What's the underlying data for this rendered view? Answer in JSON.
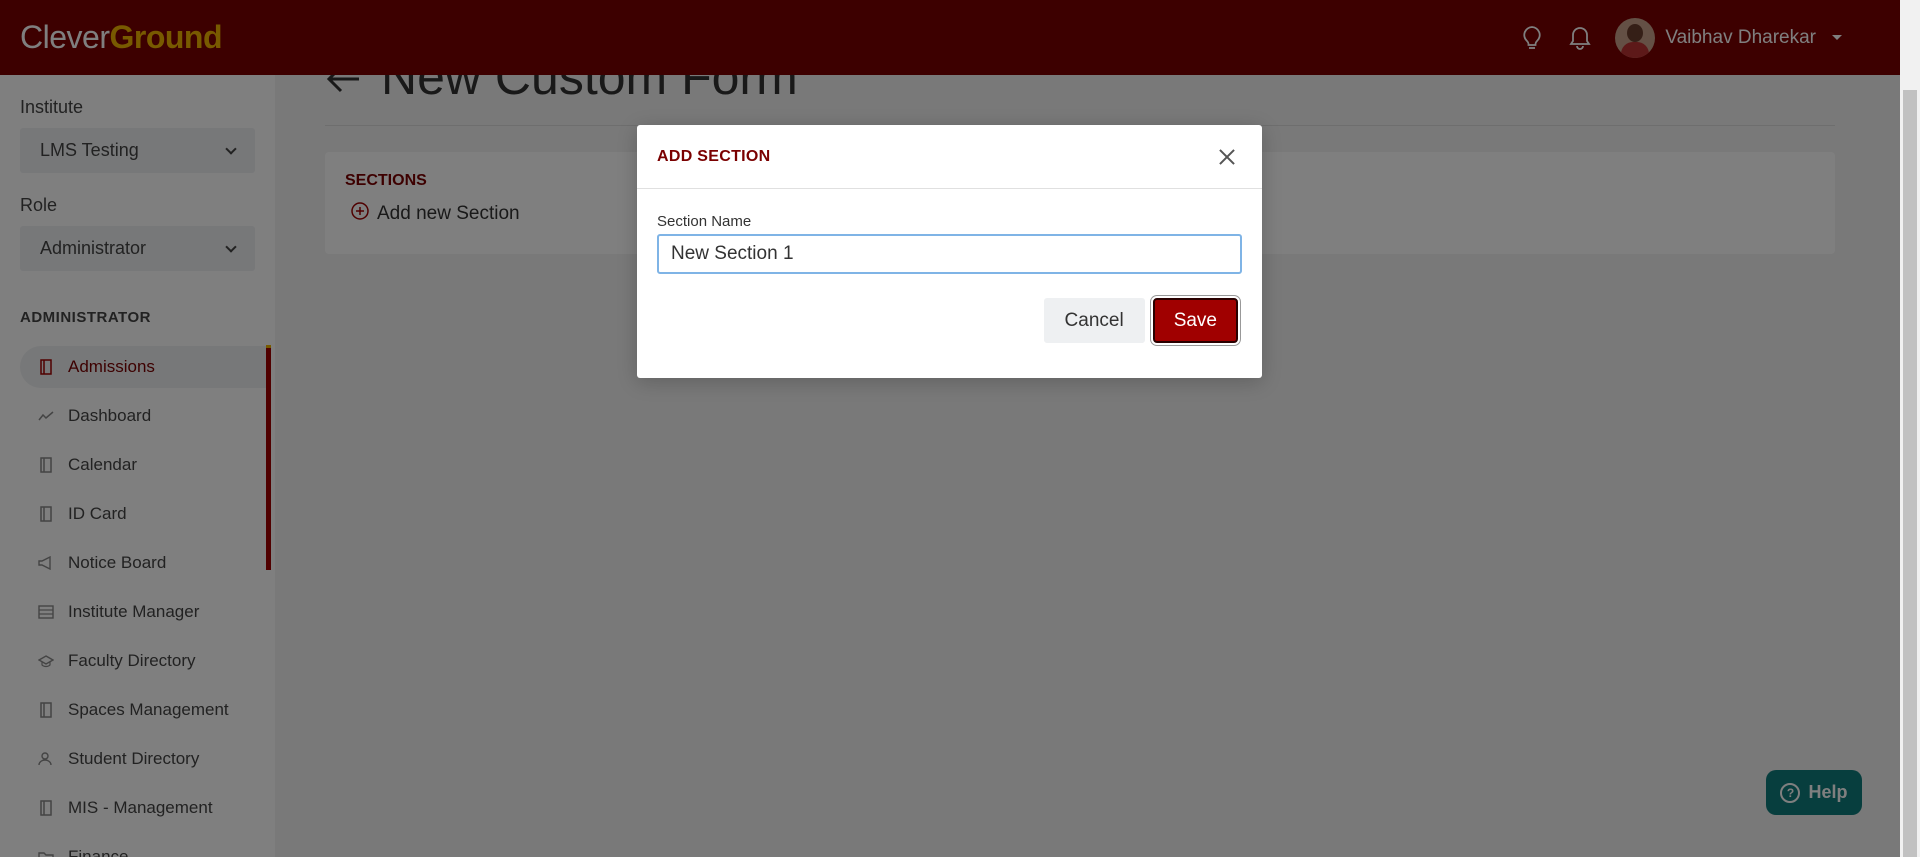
{
  "app": {
    "logo_part1": "Clever",
    "logo_part2": "Ground"
  },
  "header": {
    "user_name": "Vaibhav Dharekar",
    "icons": [
      "lightbulb-icon",
      "bell-icon",
      "avatar"
    ]
  },
  "sidebar": {
    "institute_label": "Institute",
    "institute_value": "LMS Testing",
    "role_label": "Role",
    "role_value": "Administrator",
    "section_title": "ADMINISTRATOR",
    "items": [
      {
        "label": "Admissions",
        "icon": "book-icon",
        "active": true
      },
      {
        "label": "Dashboard",
        "icon": "trend-icon",
        "active": false
      },
      {
        "label": "Calendar",
        "icon": "book-icon",
        "active": false
      },
      {
        "label": "ID Card",
        "icon": "book-icon",
        "active": false
      },
      {
        "label": "Notice Board",
        "icon": "megaphone-icon",
        "active": false
      },
      {
        "label": "Institute Manager",
        "icon": "grid-icon",
        "active": false
      },
      {
        "label": "Faculty Directory",
        "icon": "graduation-cap-icon",
        "active": false
      },
      {
        "label": "Spaces Management",
        "icon": "book-icon",
        "active": false
      },
      {
        "label": "Student Directory",
        "icon": "users-icon",
        "active": false
      },
      {
        "label": "MIS - Management",
        "icon": "book-icon",
        "active": false
      },
      {
        "label": "Finance",
        "icon": "folder-icon",
        "active": false
      }
    ]
  },
  "main": {
    "page_title": "New Custom Form",
    "sections_title": "SECTIONS",
    "add_section_label": "Add new Section"
  },
  "modal": {
    "title": "ADD SECTION",
    "field_label": "Section Name",
    "field_value": "New Section 1",
    "cancel_label": "Cancel",
    "save_label": "Save"
  },
  "help": {
    "label": "Help"
  },
  "colors": {
    "brand": "#7a0000",
    "accent": "#f0b400",
    "help": "#0f7c7c"
  }
}
